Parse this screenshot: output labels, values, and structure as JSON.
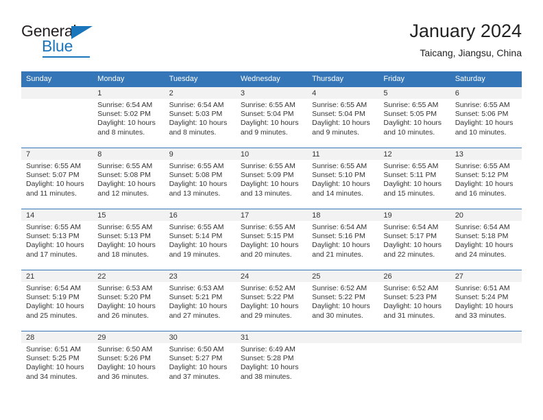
{
  "brand": {
    "name_top": "General",
    "name_bottom": "Blue",
    "accent_color": "#1b75bb"
  },
  "header": {
    "title": "January 2024",
    "subtitle": "Taicang, Jiangsu, China"
  },
  "calendar": {
    "header_bg": "#3576b8",
    "daynum_bg": "#f2f2f2",
    "weekdays": [
      "Sunday",
      "Monday",
      "Tuesday",
      "Wednesday",
      "Thursday",
      "Friday",
      "Saturday"
    ],
    "labels": {
      "sunrise": "Sunrise:",
      "sunset": "Sunset:",
      "daylight": "Daylight:"
    },
    "weeks": [
      [
        {
          "day": "",
          "sunrise": "",
          "sunset": "",
          "daylight": ""
        },
        {
          "day": "1",
          "sunrise": "Sunrise: 6:54 AM",
          "sunset": "Sunset: 5:02 PM",
          "daylight": "Daylight: 10 hours and 8 minutes."
        },
        {
          "day": "2",
          "sunrise": "Sunrise: 6:54 AM",
          "sunset": "Sunset: 5:03 PM",
          "daylight": "Daylight: 10 hours and 8 minutes."
        },
        {
          "day": "3",
          "sunrise": "Sunrise: 6:55 AM",
          "sunset": "Sunset: 5:04 PM",
          "daylight": "Daylight: 10 hours and 9 minutes."
        },
        {
          "day": "4",
          "sunrise": "Sunrise: 6:55 AM",
          "sunset": "Sunset: 5:04 PM",
          "daylight": "Daylight: 10 hours and 9 minutes."
        },
        {
          "day": "5",
          "sunrise": "Sunrise: 6:55 AM",
          "sunset": "Sunset: 5:05 PM",
          "daylight": "Daylight: 10 hours and 10 minutes."
        },
        {
          "day": "6",
          "sunrise": "Sunrise: 6:55 AM",
          "sunset": "Sunset: 5:06 PM",
          "daylight": "Daylight: 10 hours and 10 minutes."
        }
      ],
      [
        {
          "day": "7",
          "sunrise": "Sunrise: 6:55 AM",
          "sunset": "Sunset: 5:07 PM",
          "daylight": "Daylight: 10 hours and 11 minutes."
        },
        {
          "day": "8",
          "sunrise": "Sunrise: 6:55 AM",
          "sunset": "Sunset: 5:08 PM",
          "daylight": "Daylight: 10 hours and 12 minutes."
        },
        {
          "day": "9",
          "sunrise": "Sunrise: 6:55 AM",
          "sunset": "Sunset: 5:08 PM",
          "daylight": "Daylight: 10 hours and 13 minutes."
        },
        {
          "day": "10",
          "sunrise": "Sunrise: 6:55 AM",
          "sunset": "Sunset: 5:09 PM",
          "daylight": "Daylight: 10 hours and 13 minutes."
        },
        {
          "day": "11",
          "sunrise": "Sunrise: 6:55 AM",
          "sunset": "Sunset: 5:10 PM",
          "daylight": "Daylight: 10 hours and 14 minutes."
        },
        {
          "day": "12",
          "sunrise": "Sunrise: 6:55 AM",
          "sunset": "Sunset: 5:11 PM",
          "daylight": "Daylight: 10 hours and 15 minutes."
        },
        {
          "day": "13",
          "sunrise": "Sunrise: 6:55 AM",
          "sunset": "Sunset: 5:12 PM",
          "daylight": "Daylight: 10 hours and 16 minutes."
        }
      ],
      [
        {
          "day": "14",
          "sunrise": "Sunrise: 6:55 AM",
          "sunset": "Sunset: 5:13 PM",
          "daylight": "Daylight: 10 hours and 17 minutes."
        },
        {
          "day": "15",
          "sunrise": "Sunrise: 6:55 AM",
          "sunset": "Sunset: 5:13 PM",
          "daylight": "Daylight: 10 hours and 18 minutes."
        },
        {
          "day": "16",
          "sunrise": "Sunrise: 6:55 AM",
          "sunset": "Sunset: 5:14 PM",
          "daylight": "Daylight: 10 hours and 19 minutes."
        },
        {
          "day": "17",
          "sunrise": "Sunrise: 6:55 AM",
          "sunset": "Sunset: 5:15 PM",
          "daylight": "Daylight: 10 hours and 20 minutes."
        },
        {
          "day": "18",
          "sunrise": "Sunrise: 6:54 AM",
          "sunset": "Sunset: 5:16 PM",
          "daylight": "Daylight: 10 hours and 21 minutes."
        },
        {
          "day": "19",
          "sunrise": "Sunrise: 6:54 AM",
          "sunset": "Sunset: 5:17 PM",
          "daylight": "Daylight: 10 hours and 22 minutes."
        },
        {
          "day": "20",
          "sunrise": "Sunrise: 6:54 AM",
          "sunset": "Sunset: 5:18 PM",
          "daylight": "Daylight: 10 hours and 24 minutes."
        }
      ],
      [
        {
          "day": "21",
          "sunrise": "Sunrise: 6:54 AM",
          "sunset": "Sunset: 5:19 PM",
          "daylight": "Daylight: 10 hours and 25 minutes."
        },
        {
          "day": "22",
          "sunrise": "Sunrise: 6:53 AM",
          "sunset": "Sunset: 5:20 PM",
          "daylight": "Daylight: 10 hours and 26 minutes."
        },
        {
          "day": "23",
          "sunrise": "Sunrise: 6:53 AM",
          "sunset": "Sunset: 5:21 PM",
          "daylight": "Daylight: 10 hours and 27 minutes."
        },
        {
          "day": "24",
          "sunrise": "Sunrise: 6:52 AM",
          "sunset": "Sunset: 5:22 PM",
          "daylight": "Daylight: 10 hours and 29 minutes."
        },
        {
          "day": "25",
          "sunrise": "Sunrise: 6:52 AM",
          "sunset": "Sunset: 5:22 PM",
          "daylight": "Daylight: 10 hours and 30 minutes."
        },
        {
          "day": "26",
          "sunrise": "Sunrise: 6:52 AM",
          "sunset": "Sunset: 5:23 PM",
          "daylight": "Daylight: 10 hours and 31 minutes."
        },
        {
          "day": "27",
          "sunrise": "Sunrise: 6:51 AM",
          "sunset": "Sunset: 5:24 PM",
          "daylight": "Daylight: 10 hours and 33 minutes."
        }
      ],
      [
        {
          "day": "28",
          "sunrise": "Sunrise: 6:51 AM",
          "sunset": "Sunset: 5:25 PM",
          "daylight": "Daylight: 10 hours and 34 minutes."
        },
        {
          "day": "29",
          "sunrise": "Sunrise: 6:50 AM",
          "sunset": "Sunset: 5:26 PM",
          "daylight": "Daylight: 10 hours and 36 minutes."
        },
        {
          "day": "30",
          "sunrise": "Sunrise: 6:50 AM",
          "sunset": "Sunset: 5:27 PM",
          "daylight": "Daylight: 10 hours and 37 minutes."
        },
        {
          "day": "31",
          "sunrise": "Sunrise: 6:49 AM",
          "sunset": "Sunset: 5:28 PM",
          "daylight": "Daylight: 10 hours and 38 minutes."
        },
        {
          "day": "",
          "sunrise": "",
          "sunset": "",
          "daylight": ""
        },
        {
          "day": "",
          "sunrise": "",
          "sunset": "",
          "daylight": ""
        },
        {
          "day": "",
          "sunrise": "",
          "sunset": "",
          "daylight": ""
        }
      ]
    ]
  }
}
